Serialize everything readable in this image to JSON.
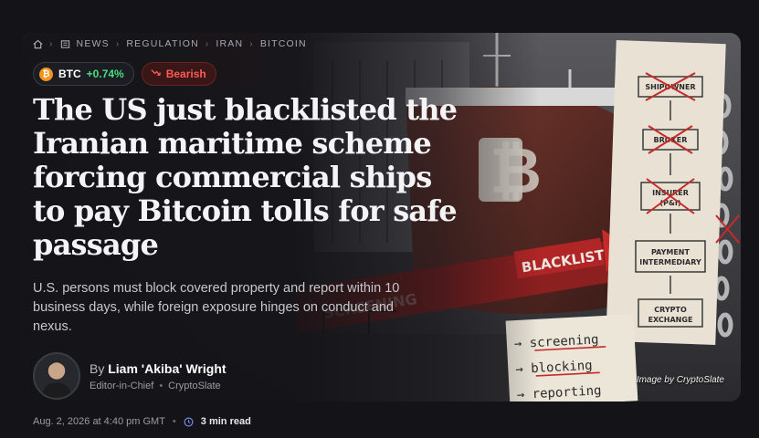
{
  "breadcrumb": {
    "items": [
      "NEWS",
      "REGULATION",
      "IRAN",
      "BITCOIN"
    ]
  },
  "ticker": {
    "symbol": "BTC",
    "change": "+0.74%",
    "sentiment": "Bearish",
    "colors": {
      "up": "#4ade80",
      "bearish": "#ff5a5a",
      "btc": "#f7931a"
    }
  },
  "article": {
    "headline": "The US just blacklisted the Iranian maritime scheme forcing commercial ships to pay Bitcoin tolls for safe passage",
    "dek": "U.S. persons must block covered property and report within 10 business days, while foreign exposure hinges on conduct and nexus.",
    "image_credit": "Image by CryptoSlate",
    "date": "Aug. 2, 2026 at 4:40 pm GMT",
    "read_time": "3 min read"
  },
  "author": {
    "by": "By",
    "name": "Liam 'Akiba' Wright",
    "role": "Editor-in-Chief",
    "outlet": "CryptoSlate"
  },
  "art": {
    "flow_steps": [
      "SHIPOWNER",
      "BROKER",
      "INSURER (P&I)",
      "PAYMENT INTERMEDIARY",
      "CRYPTO EXCHANGE"
    ],
    "notes": [
      "screening",
      "blocking",
      "reporting"
    ],
    "stamp": "BLACKLIST",
    "hull_text": "SCREENING"
  }
}
